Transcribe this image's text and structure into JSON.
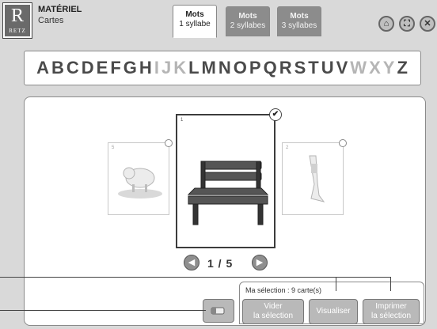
{
  "header": {
    "logo_letter": "R",
    "logo_text": "RETZ",
    "title": "MATÉRIEL",
    "subtitle": "Cartes"
  },
  "tabs": [
    {
      "line1": "Mots",
      "line2": "1 syllabe",
      "active": true
    },
    {
      "line1": "Mots",
      "line2": "2 syllabes",
      "active": false
    },
    {
      "line1": "Mots",
      "line2": "3 syllabes",
      "active": false
    }
  ],
  "controls": [
    {
      "icon": "home-icon",
      "glyph": "⌂"
    },
    {
      "icon": "fullscreen-icon",
      "glyph": "⛶"
    },
    {
      "icon": "close-icon",
      "glyph": "✕"
    }
  ],
  "alphabet": {
    "letters": [
      "A",
      "B",
      "C",
      "D",
      "E",
      "F",
      "G",
      "H",
      "I",
      "J",
      "K",
      "L",
      "M",
      "N",
      "O",
      "P",
      "Q",
      "R",
      "S",
      "T",
      "U",
      "V",
      "W",
      "X",
      "Y",
      "Z"
    ],
    "disabled": [
      "I",
      "J",
      "K",
      "W",
      "X",
      "Y"
    ],
    "color_enabled": "#4a4a4a",
    "color_disabled": "#b5b5b5"
  },
  "cards": {
    "left": {
      "number": "5",
      "subject": "pig-in-mud"
    },
    "center": {
      "number": "1",
      "subject": "bench",
      "checked": true,
      "check_glyph": "✔"
    },
    "right": {
      "number": "2",
      "subject": "leg"
    }
  },
  "pager": {
    "prev_glyph": "◀",
    "next_glyph": "▶",
    "text": "1 / 5"
  },
  "selection": {
    "label": "Ma sélection : 9 carte(s)",
    "clear_line1": "Vider",
    "clear_line2": "la sélection",
    "view": "Visualiser",
    "print_line1": "Imprimer",
    "print_line2": "la sélection"
  }
}
